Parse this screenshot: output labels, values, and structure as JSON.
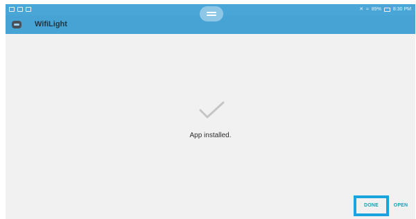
{
  "status_bar": {
    "battery_text": "89%",
    "time": "8:30 PM"
  },
  "app_bar": {
    "title": "WifiLight"
  },
  "install": {
    "message": "App installed."
  },
  "actions": {
    "done_label": "DONE",
    "open_label": "OPEN"
  },
  "icons": {
    "app": "app-launcher-icon",
    "status": [
      "mute-icon",
      "wifi-icon",
      "battery-icon"
    ],
    "check": "check-icon"
  },
  "colors": {
    "accent": "#47a3d4",
    "button_text": "#16a0b8",
    "highlight": "#19a4de"
  }
}
